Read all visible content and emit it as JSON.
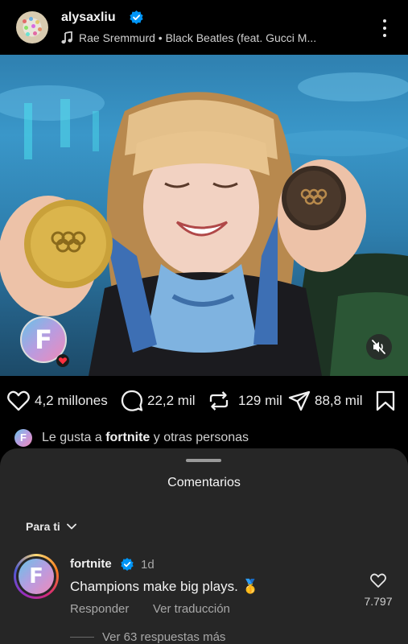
{
  "post": {
    "username": "alysaxliu",
    "music": "Rae Sremmurd • Black Beatles (feat. Gucci M..."
  },
  "actions": {
    "likes": "4,2 millones",
    "comments": "22,2 mil",
    "reposts": "129 mil",
    "shares": "88,8 mil"
  },
  "liked_by": {
    "prefix": "Le gusta a",
    "user": "fortnite",
    "suffix": "y otras personas"
  },
  "comments_sheet": {
    "title": "Comentarios",
    "sort_label": "Para ti",
    "comment": {
      "username": "fortnite",
      "time": "1d",
      "text": "Champions make big plays. 🥇",
      "reply_label": "Responder",
      "translate_label": "Ver traducción",
      "like_count": "7.797",
      "view_replies": "Ver 63 respuestas más"
    }
  },
  "colors": {
    "background": "#000000",
    "sheet": "#262626",
    "verified": "#0095f6"
  }
}
